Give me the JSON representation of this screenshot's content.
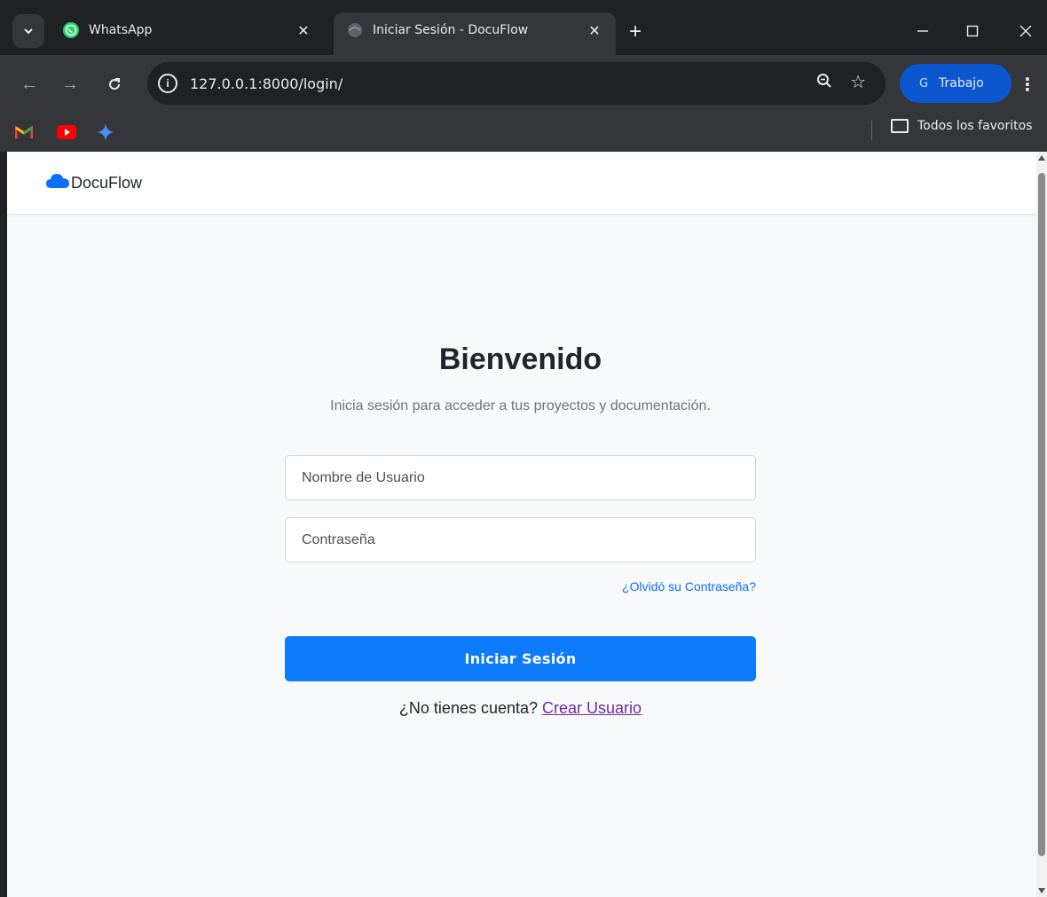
{
  "browser": {
    "tabs": [
      {
        "title": "WhatsApp",
        "icon": "whatsapp-icon",
        "active": false
      },
      {
        "title": "Iniciar Sesión - DocuFlow",
        "icon": "globe-icon",
        "active": true
      }
    ],
    "url": "127.0.0.1:8000/login/",
    "profile": {
      "initial": "G",
      "name": "Trabajo"
    },
    "bookmarks": {
      "items": [
        "gmail-icon",
        "youtube-icon",
        "gemini-icon"
      ],
      "all_bookmarks_label": "Todos los favoritos"
    },
    "colors": {
      "frame": "#202124",
      "toolbar": "#35363a",
      "profile_chip": "#0b57d0"
    }
  },
  "site": {
    "brand": "DocuFlow",
    "brand_icon": "cloud-icon"
  },
  "login": {
    "heading": "Bienvenido",
    "subtitle": "Inicia sesión para acceder a tus proyectos y documentación.",
    "username_placeholder": "Nombre de Usuario",
    "username_value": "",
    "password_placeholder": "Contraseña",
    "password_value": "",
    "forgot_link": "¿Olvidó su Contraseña?",
    "submit_label": "Iniciar Sesión",
    "no_account_text": "¿No tienes cuenta?",
    "create_user_link": "Crear Usuario"
  },
  "colors": {
    "primary": "#0d7bfa",
    "link": "#0d6efd",
    "visited_link": "#6a2d9f",
    "page_bg": "#f8f9fa"
  }
}
